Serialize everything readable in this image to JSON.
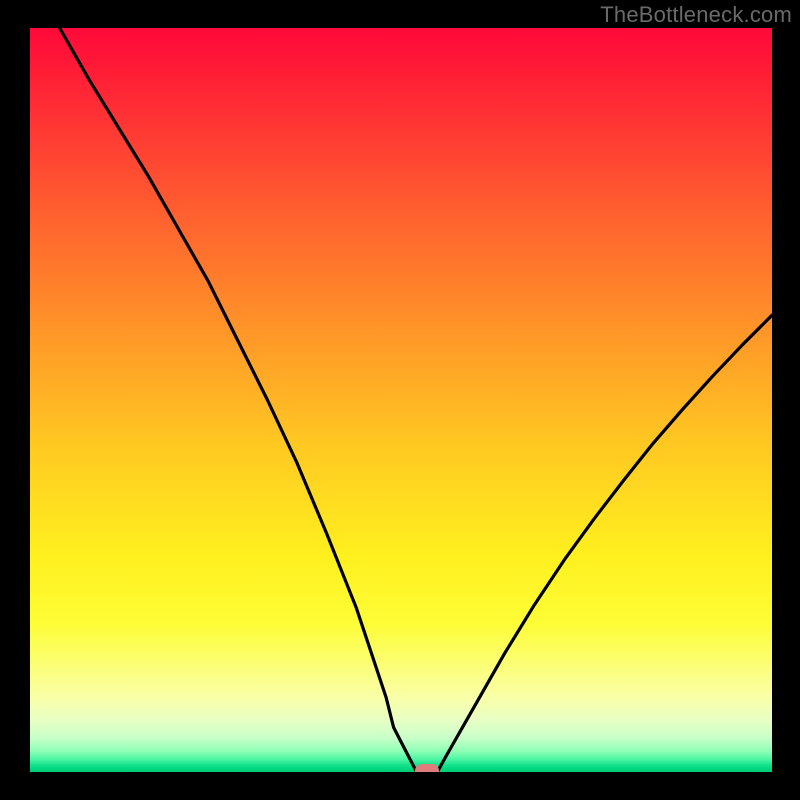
{
  "watermark": "TheBottleneck.com",
  "colors": {
    "frame_bg": "#000000",
    "curve": "#000000",
    "marker": "#dd7d7c",
    "watermark": "#6a6a6a"
  },
  "chart_data": {
    "type": "line",
    "title": "",
    "xlabel": "",
    "ylabel": "",
    "xlim": [
      0,
      100
    ],
    "ylim": [
      0,
      100
    ],
    "grid": false,
    "legend": false,
    "series": [
      {
        "name": "bottleneck-curve",
        "x": [
          4,
          8,
          12,
          16,
          20,
          24,
          28,
          32,
          36,
          40,
          44,
          48,
          49,
          52,
          55,
          56,
          60,
          64,
          68,
          72,
          76,
          80,
          84,
          88,
          92,
          96,
          100
        ],
        "values": [
          100,
          93,
          86.5,
          80,
          73,
          66,
          58,
          50,
          41.5,
          32,
          22,
          10,
          6,
          0.2,
          0.2,
          2,
          9,
          16,
          22.5,
          28.5,
          34,
          39.2,
          44.2,
          48.8,
          53.2,
          57.4,
          61.4
        ]
      }
    ],
    "marker": {
      "x": 53.5,
      "y": 0.2
    },
    "gradient_stops": [
      {
        "pct": 0,
        "hex": "#ff0a3a"
      },
      {
        "pct": 15,
        "hex": "#ff3d34"
      },
      {
        "pct": 42,
        "hex": "#ff9a28"
      },
      {
        "pct": 71,
        "hex": "#fff01f"
      },
      {
        "pct": 90,
        "hex": "#f9ffa8"
      },
      {
        "pct": 97,
        "hex": "#8dffb5"
      },
      {
        "pct": 100,
        "hex": "#00cb74"
      }
    ]
  }
}
